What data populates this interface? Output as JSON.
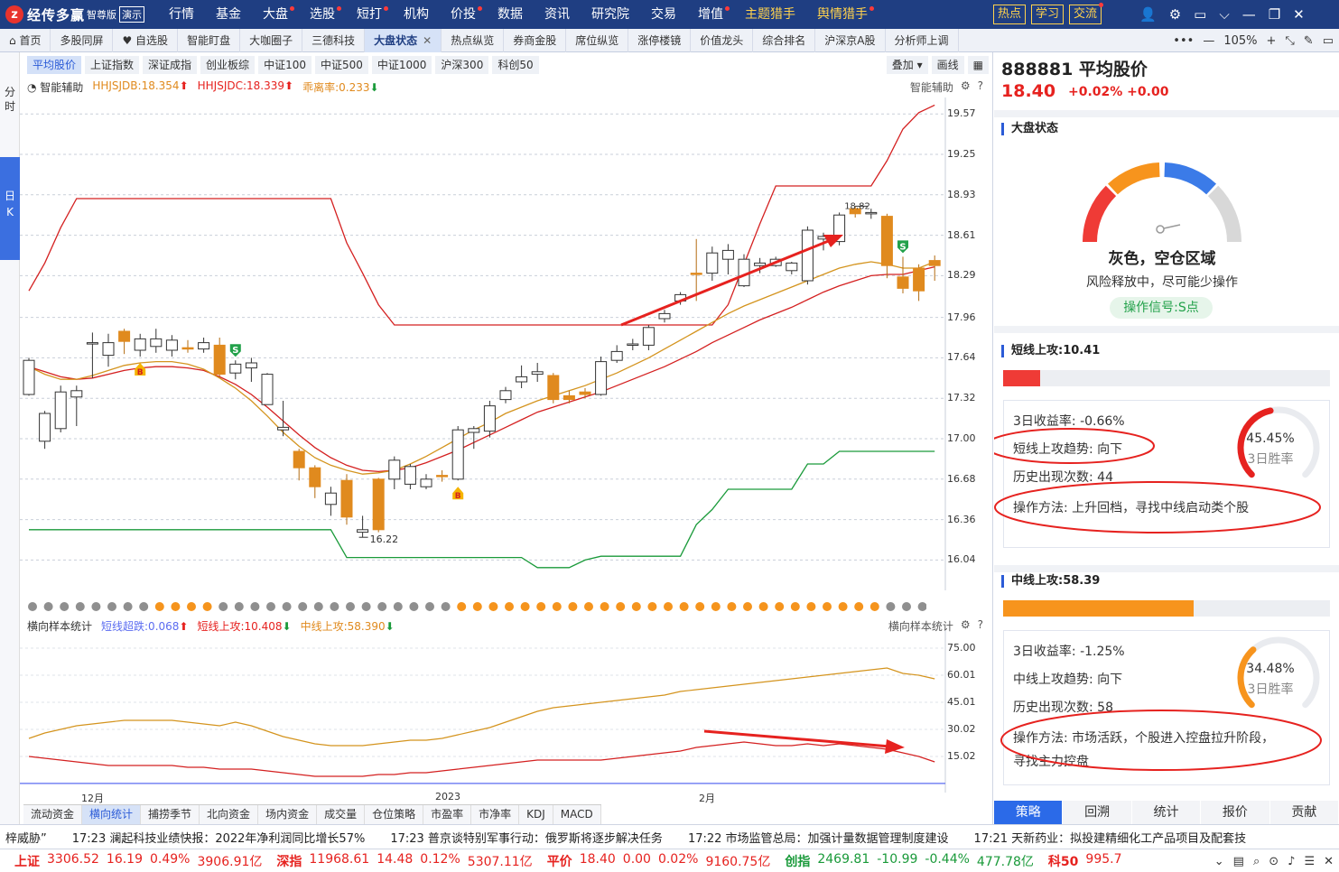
{
  "app": {
    "logo_mark": "z",
    "name": "经传多赢",
    "edition": "智尊版",
    "demo": "演示"
  },
  "menu": [
    {
      "label": "行情",
      "dot": false
    },
    {
      "label": "基金",
      "dot": false
    },
    {
      "label": "大盘",
      "dot": true
    },
    {
      "label": "选股",
      "dot": true
    },
    {
      "label": "短打",
      "dot": true
    },
    {
      "label": "机构",
      "dot": false
    },
    {
      "label": "价投",
      "dot": true
    },
    {
      "label": "数据",
      "dot": false
    },
    {
      "label": "资讯",
      "dot": false
    },
    {
      "label": "研究院",
      "dot": false
    },
    {
      "label": "交易",
      "dot": false
    },
    {
      "label": "增值",
      "dot": true
    },
    {
      "label": "主题猎手",
      "dot": false,
      "yellow": true
    },
    {
      "label": "舆情猎手",
      "dot": true,
      "yellow": true
    }
  ],
  "pills": [
    {
      "label": "热点",
      "dot": false
    },
    {
      "label": "学习",
      "dot": false
    },
    {
      "label": "交流",
      "dot": true
    }
  ],
  "top_icons": {
    "user": "👤",
    "settings": "⚙",
    "window": "▭",
    "chevron": "⌵",
    "minimize": "—",
    "restore": "❐",
    "close": "✕"
  },
  "tabs": [
    "首页",
    "多股同屏",
    "自选股",
    "智能盯盘",
    "大咖圈子",
    "三德科技",
    "大盘状态",
    "热点纵览",
    "券商金股",
    "席位纵览",
    "涨停楼镜",
    "价值龙头",
    "综合排名",
    "沪深京A股",
    "分析师上调"
  ],
  "active_tab": "大盘状态",
  "tab_tools": {
    "more": "•••",
    "minus": "—",
    "zoom": "105%",
    "plus": "+",
    "arrows": "⤡",
    "pen": "✎",
    "window": "▭"
  },
  "left_rail": {
    "minute": "分时",
    "day": "日K"
  },
  "index_tabs": [
    "平均股价",
    "上证指数",
    "深证成指",
    "创业板综",
    "中证100",
    "中证500",
    "中证1000",
    "沪深300",
    "科创50"
  ],
  "active_index_tab": "平均股价",
  "chart_tools": {
    "overlay": "叠加",
    "draw": "画线"
  },
  "main_legend": {
    "assist": "智能辅助",
    "hhjsjdb": "HHJSJDB:18.354",
    "hhjsjdc": "HHJSJDC:18.339",
    "quli": "乖离率:0.233",
    "right_label": "智能辅助"
  },
  "sub_legend": {
    "name": "横向样本统计",
    "short_drop": "短线超跌:0.068",
    "short_up": "短线上攻:10.408",
    "mid_up": "中线上攻:58.390",
    "right_label": "横向样本统计"
  },
  "y_axis_main": [
    "19.57",
    "19.25",
    "18.93",
    "18.61",
    "18.29",
    "17.96",
    "17.64",
    "17.32",
    "17.00",
    "16.68",
    "16.36",
    "16.04"
  ],
  "y_axis_sub": [
    "75.00",
    "60.01",
    "45.01",
    "30.02",
    "15.02"
  ],
  "x_axis": [
    "12月",
    "2023",
    "2月"
  ],
  "annotations": {
    "high": "18.82",
    "low": "16.22",
    "b_mark": "B",
    "s_mark": "S"
  },
  "bottom_tabs": [
    "流动资金",
    "横向统计",
    "捕捞季节",
    "北向资金",
    "场内资金",
    "成交量",
    "仓位策略",
    "市盈率",
    "市净率",
    "KDJ",
    "MACD"
  ],
  "active_bottom_tab": "横向统计",
  "stock": {
    "code_name": "888881 平均股价",
    "price": "18.40",
    "change": "+0.02% +0.00"
  },
  "market_state": {
    "title": "大盘状态",
    "status": "灰色，空仓区域",
    "desc": "风险释放中，尽可能少操作",
    "signal": "操作信号:S点",
    "gauge_colors": [
      "#ef3b36",
      "#f7941d",
      "#3b7be8",
      "#d8d8d8"
    ],
    "needle_value": "grey zone"
  },
  "short_attack": {
    "title": "短线上攻:10.41",
    "fill_fraction": 0.114,
    "color": "#ef3b36",
    "ret_3d": "3日收益率: -0.66%",
    "trend": "短线上攻趋势: 向下",
    "count": "历史出现次数: 44",
    "method": "操作方法: 上升回档，寻找中线启动类个股",
    "win_pct": "45.45%",
    "win_fraction": 0.4545,
    "win_label": "3日胜率"
  },
  "mid_attack": {
    "title": "中线上攻:58.39",
    "fill_fraction": 0.5839,
    "color": "#f7941d",
    "ret_3d": "3日收益率: -1.25%",
    "trend": "中线上攻趋势: 向下",
    "count": "历史出现次数: 58",
    "method_1": "操作方法: 市场活跃，个股进入控盘拉升阶段，",
    "method_2": "寻找主力控盘",
    "win_pct": "34.48%",
    "win_fraction": 0.3448,
    "win_label": "3日胜率"
  },
  "right_tabs": [
    "策略",
    "回溯",
    "统计",
    "报价",
    "贡献"
  ],
  "active_right_tab": "策略",
  "news": [
    "梓威胁”",
    "17:23 澜起科技业绩快报：2022年净利润同比增长57%",
    "17:23 普京谈特别军事行动：俄罗斯将逐步解决任务",
    "17:22 市场监管总局：加强计量数据管理制度建设",
    "17:21 天新药业：拟投建精细化工产品项目及配套技"
  ],
  "ticker": [
    {
      "name": "上证",
      "price": "3306.52",
      "chg": "16.19",
      "pct": "0.49%",
      "amt": "3906.91亿",
      "dir": "up"
    },
    {
      "name": "深指",
      "price": "11968.61",
      "chg": "14.48",
      "pct": "0.12%",
      "amt": "5307.11亿",
      "dir": "up"
    },
    {
      "name": "平价",
      "price": "18.40",
      "chg": "0.00",
      "pct": "0.02%",
      "amt": "9160.75亿",
      "dir": "up"
    },
    {
      "name": "创指",
      "price": "2469.81",
      "chg": "-10.99",
      "pct": "-0.44%",
      "amt": "477.78亿",
      "dir": "dn"
    },
    {
      "name": "科50",
      "price": "995.7",
      "chg": "",
      "pct": "",
      "amt": "",
      "dir": "up"
    }
  ],
  "ticker_icons": [
    "⌄",
    "▤",
    "⌕",
    "⊙",
    "♪",
    "☰",
    "✕"
  ],
  "chart_data": {
    "type": "candlestick",
    "ylim": [
      15.8,
      19.7
    ],
    "candles": [
      [
        17.35,
        17.62,
        17.64,
        17.34
      ],
      [
        16.98,
        17.2,
        17.22,
        16.92
      ],
      [
        17.08,
        17.37,
        17.42,
        17.05
      ],
      [
        17.33,
        17.38,
        17.42,
        17.1
      ],
      [
        17.76,
        17.76,
        17.84,
        17.48
      ],
      [
        17.66,
        17.76,
        17.83,
        17.57
      ],
      [
        17.85,
        17.77,
        17.87,
        17.67
      ],
      [
        17.7,
        17.79,
        17.83,
        17.65
      ],
      [
        17.73,
        17.79,
        17.87,
        17.68
      ],
      [
        17.7,
        17.78,
        17.82,
        17.65
      ],
      [
        17.72,
        17.71,
        17.78,
        17.68
      ],
      [
        17.71,
        17.76,
        17.8,
        17.68
      ],
      [
        17.74,
        17.51,
        17.8,
        17.49
      ],
      [
        17.52,
        17.59,
        17.62,
        17.47
      ],
      [
        17.56,
        17.6,
        17.64,
        17.45
      ],
      [
        17.27,
        17.51,
        17.52,
        17.27
      ],
      [
        17.07,
        17.09,
        17.3,
        17.02
      ],
      [
        16.9,
        16.77,
        16.92,
        16.67
      ],
      [
        16.77,
        16.62,
        16.79,
        16.53
      ],
      [
        16.48,
        16.57,
        16.62,
        16.39
      ],
      [
        16.67,
        16.38,
        16.72,
        16.32
      ],
      [
        16.26,
        16.28,
        16.39,
        16.22
      ],
      [
        16.68,
        16.28,
        16.69,
        16.26
      ],
      [
        16.68,
        16.83,
        16.86,
        16.6
      ],
      [
        16.64,
        16.78,
        16.8,
        16.6
      ],
      [
        16.62,
        16.68,
        16.72,
        16.6
      ],
      [
        16.71,
        16.7,
        16.75,
        16.66
      ],
      [
        16.68,
        17.07,
        17.1,
        16.67
      ],
      [
        17.05,
        17.08,
        17.1,
        16.92
      ],
      [
        17.06,
        17.26,
        17.3,
        17.01
      ],
      [
        17.31,
        17.38,
        17.41,
        17.28
      ],
      [
        17.45,
        17.49,
        17.58,
        17.4
      ],
      [
        17.51,
        17.53,
        17.6,
        17.45
      ],
      [
        17.5,
        17.31,
        17.52,
        17.28
      ],
      [
        17.34,
        17.31,
        17.38,
        17.28
      ],
      [
        17.37,
        17.35,
        17.4,
        17.32
      ],
      [
        17.35,
        17.61,
        17.65,
        17.34
      ],
      [
        17.62,
        17.69,
        17.74,
        17.6
      ],
      [
        17.74,
        17.75,
        17.79,
        17.7
      ],
      [
        17.74,
        17.88,
        17.9,
        17.7
      ],
      [
        17.95,
        17.99,
        18.02,
        17.92
      ],
      [
        18.09,
        18.14,
        18.16,
        18.06
      ],
      [
        18.31,
        18.3,
        18.58,
        18.09
      ],
      [
        18.31,
        18.47,
        18.52,
        18.25
      ],
      [
        18.42,
        18.49,
        18.54,
        18.3
      ],
      [
        18.21,
        18.42,
        18.46,
        18.2
      ],
      [
        18.37,
        18.39,
        18.43,
        18.31
      ],
      [
        18.37,
        18.42,
        18.44,
        18.36
      ],
      [
        18.33,
        18.39,
        18.4,
        18.3
      ],
      [
        18.25,
        18.65,
        18.68,
        18.22
      ],
      [
        18.58,
        18.6,
        18.63,
        18.49
      ],
      [
        18.56,
        18.77,
        18.79,
        18.53
      ],
      [
        18.82,
        18.78,
        18.84,
        18.75
      ],
      [
        18.78,
        18.79,
        18.82,
        18.74
      ],
      [
        18.76,
        18.37,
        18.78,
        18.27
      ],
      [
        18.28,
        18.19,
        18.44,
        18.15
      ],
      [
        18.35,
        18.17,
        18.38,
        18.09
      ],
      [
        18.41,
        18.37,
        18.45,
        18.25
      ]
    ],
    "upper_band": [
      18.17,
      18.39,
      18.67,
      18.9,
      18.9,
      18.9,
      18.9,
      18.9,
      18.9,
      18.9,
      18.9,
      18.9,
      18.9,
      18.9,
      18.9,
      18.9,
      18.9,
      18.9,
      18.9,
      18.9,
      18.55,
      18.31,
      18.06,
      17.9,
      17.9,
      17.9,
      17.9,
      17.9,
      17.9,
      17.9,
      17.9,
      17.9,
      17.9,
      17.9,
      17.9,
      17.9,
      17.9,
      17.9,
      17.9,
      17.9,
      17.9,
      17.9,
      17.9,
      17.9,
      18.06,
      18.38,
      18.7,
      19.0,
      19.0,
      19.0,
      19.0,
      19.0,
      19.0,
      19.0,
      19.2,
      19.45,
      19.58,
      19.64
    ],
    "lower_band": [
      16.28,
      16.28,
      16.28,
      16.28,
      16.28,
      16.28,
      16.28,
      16.28,
      16.28,
      16.28,
      16.28,
      16.28,
      16.28,
      16.28,
      16.28,
      16.28,
      16.28,
      16.28,
      16.28,
      16.28,
      16.06,
      16.06,
      16.06,
      16.06,
      16.06,
      16.06,
      16.06,
      16.06,
      16.06,
      16.06,
      16.06,
      16.06,
      15.98,
      15.98,
      15.98,
      16.04,
      16.07,
      16.07,
      16.07,
      16.07,
      16.07,
      16.07,
      16.32,
      16.44,
      16.6,
      16.6,
      16.6,
      16.6,
      16.6,
      16.8,
      16.8,
      16.9,
      16.9,
      16.9,
      16.9,
      16.9,
      16.9,
      16.9
    ],
    "ma_slow": [
      17.57,
      17.53,
      17.49,
      17.47,
      17.48,
      17.51,
      17.54,
      17.56,
      17.57,
      17.57,
      17.56,
      17.54,
      17.49,
      17.43,
      17.35,
      17.25,
      17.14,
      17.03,
      16.93,
      16.85,
      16.79,
      16.75,
      16.74,
      16.75,
      16.77,
      16.81,
      16.86,
      16.91,
      16.97,
      17.03,
      17.09,
      17.15,
      17.21,
      17.25,
      17.29,
      17.33,
      17.37,
      17.42,
      17.47,
      17.52,
      17.57,
      17.63,
      17.69,
      17.76,
      17.82,
      17.88,
      17.94,
      17.99,
      18.04,
      18.1,
      18.16,
      18.21,
      18.25,
      18.29,
      18.3,
      18.3,
      18.33,
      18.36
    ],
    "ma_fast": [
      17.57,
      17.51,
      17.47,
      17.47,
      17.5,
      17.54,
      17.58,
      17.6,
      17.61,
      17.61,
      17.59,
      17.55,
      17.48,
      17.4,
      17.3,
      17.18,
      17.05,
      16.94,
      16.85,
      16.79,
      16.75,
      16.72,
      16.73,
      16.75,
      16.8,
      16.86,
      16.93,
      17.0,
      17.07,
      17.13,
      17.2,
      17.25,
      17.3,
      17.34,
      17.38,
      17.42,
      17.47,
      17.52,
      17.58,
      17.64,
      17.71,
      17.78,
      17.85,
      17.92,
      17.99,
      18.05,
      18.1,
      18.15,
      18.2,
      18.25,
      18.3,
      18.35,
      18.38,
      18.4,
      18.38,
      18.35,
      18.35,
      18.4
    ],
    "buy_marks": [
      7,
      27
    ],
    "sell_marks": [
      13,
      55
    ],
    "sub_ylim": [
      0,
      80
    ],
    "mid_line": [
      25,
      28,
      30,
      32,
      33,
      34,
      35,
      35,
      35,
      35,
      34,
      33,
      32,
      34,
      32,
      29,
      26,
      24,
      22,
      21,
      21,
      21,
      22,
      23,
      24,
      24,
      25,
      27,
      29,
      31,
      34,
      37,
      40,
      42,
      43,
      44,
      45,
      46,
      47,
      48,
      49,
      51,
      52,
      53,
      54,
      55,
      56,
      57,
      58,
      59,
      60,
      61,
      62,
      63,
      64,
      61,
      60,
      58
    ],
    "short_line": [
      15,
      14,
      13,
      12,
      11,
      10,
      10,
      10,
      10,
      10,
      9,
      9,
      8,
      8,
      8,
      7,
      6,
      5,
      4,
      4,
      4,
      4,
      5,
      5,
      6,
      6,
      7,
      8,
      9,
      10,
      11,
      12,
      13,
      13,
      13,
      13,
      13,
      14,
      15,
      16,
      17,
      18,
      20,
      21,
      22,
      23,
      22,
      21,
      21,
      22,
      21,
      22,
      21,
      20,
      19,
      17,
      15,
      12
    ]
  }
}
